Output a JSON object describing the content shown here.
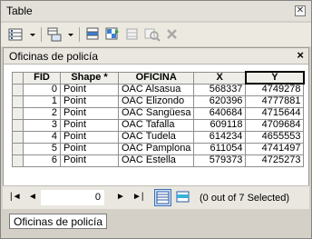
{
  "window": {
    "title": "Table"
  },
  "toolbar": {
    "icons": [
      "table-options-icon",
      "related-tables-icon",
      "select-by-attributes-icon",
      "switch-selection-icon",
      "clear-selection-icon",
      "zoom-to-selected-icon",
      "delete-selected-icon"
    ]
  },
  "panel": {
    "title": "Oficinas de policía"
  },
  "table": {
    "columns": [
      "FID",
      "Shape *",
      "OFICINA",
      "X",
      "Y"
    ],
    "rows": [
      {
        "fid": "0",
        "shape": "Point",
        "oficina": "OAC Alsasua",
        "x": "568337",
        "y": "4749278"
      },
      {
        "fid": "1",
        "shape": "Point",
        "oficina": "OAC Elizondo",
        "x": "620396",
        "y": "4777881"
      },
      {
        "fid": "2",
        "shape": "Point",
        "oficina": "OAC Sangüesa",
        "x": "640684",
        "y": "4715644"
      },
      {
        "fid": "3",
        "shape": "Point",
        "oficina": "OAC Tafalla",
        "x": "609118",
        "y": "4709684"
      },
      {
        "fid": "4",
        "shape": "Point",
        "oficina": "OAC Tudela",
        "x": "614234",
        "y": "4655553"
      },
      {
        "fid": "5",
        "shape": "Point",
        "oficina": "OAC Pamplona",
        "x": "611054",
        "y": "4741497"
      },
      {
        "fid": "6",
        "shape": "Point",
        "oficina": "OAC Estella",
        "x": "579373",
        "y": "4725273"
      }
    ]
  },
  "navigation": {
    "first": "|◄",
    "prev": "◄",
    "current_record": "0",
    "next": "►",
    "last": "►|",
    "status": "(0 out of 7 Selected)"
  },
  "tabs": [
    {
      "label": "Oficinas de policía",
      "active": true
    }
  ]
}
